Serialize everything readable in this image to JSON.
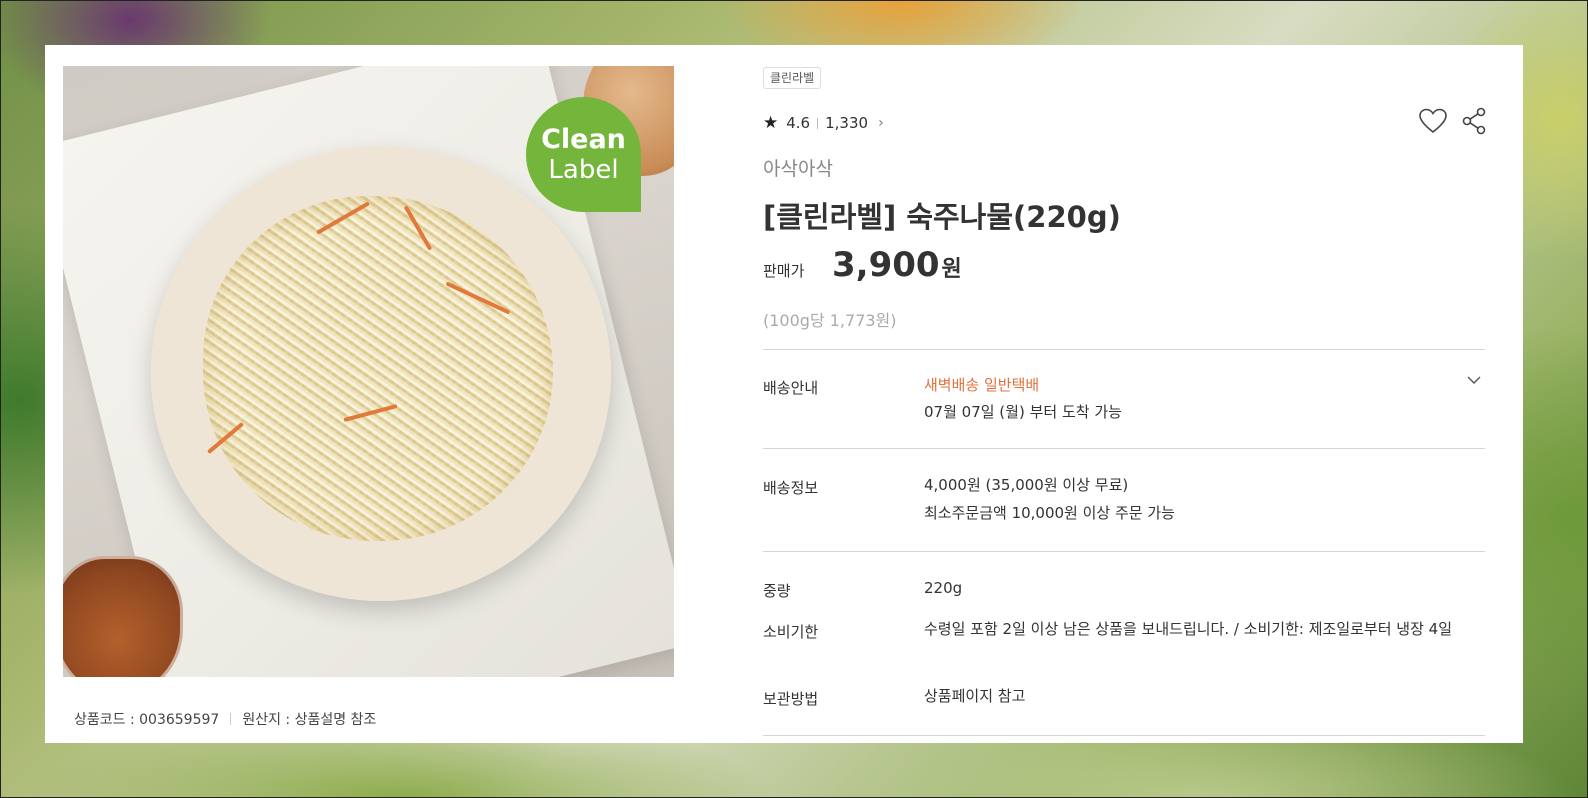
{
  "product": {
    "badge_line1": "Clean",
    "badge_line2": "Label",
    "code": "상품코드 : 003659597",
    "origin": "원산지 : 상품설명 참조",
    "tag": "클린라벨",
    "rating": "4.6",
    "review_count": "1,330",
    "brand": "아삭아삭",
    "title": "[클린라벨] 숙주나물(220g)",
    "price_label": "판매가",
    "price": "3,900",
    "price_unit": "원",
    "unit_price": "(100g당 1,773원)"
  },
  "delivery": {
    "label": "배송안내",
    "types": "새벽배송 일반택배",
    "arrival": "07월 07일 (월) 부터 도착 가능"
  },
  "shipping": {
    "label": "배송정보",
    "fee": "4,000원 (35,000원 이상 무료)",
    "minimum": "최소주문금액 10,000원 이상 주문 가능"
  },
  "specs": {
    "weight_label": "중량",
    "weight": "220g",
    "expiry_label": "소비기한",
    "expiry": "수령일 포함 2일 이상 남은 상품을 보내드립니다. / 소비기한: 제조일로부터 냉장 4일",
    "storage_label": "보관방법",
    "storage": "상품페이지 참고"
  },
  "icons": {
    "star": "star-icon",
    "chevron": "chevron-right-icon",
    "heart": "heart-icon",
    "share": "share-icon",
    "expand": "chevron-down-icon"
  },
  "colors": {
    "accent": "#e2733c",
    "badge_green": "#74b53c"
  }
}
